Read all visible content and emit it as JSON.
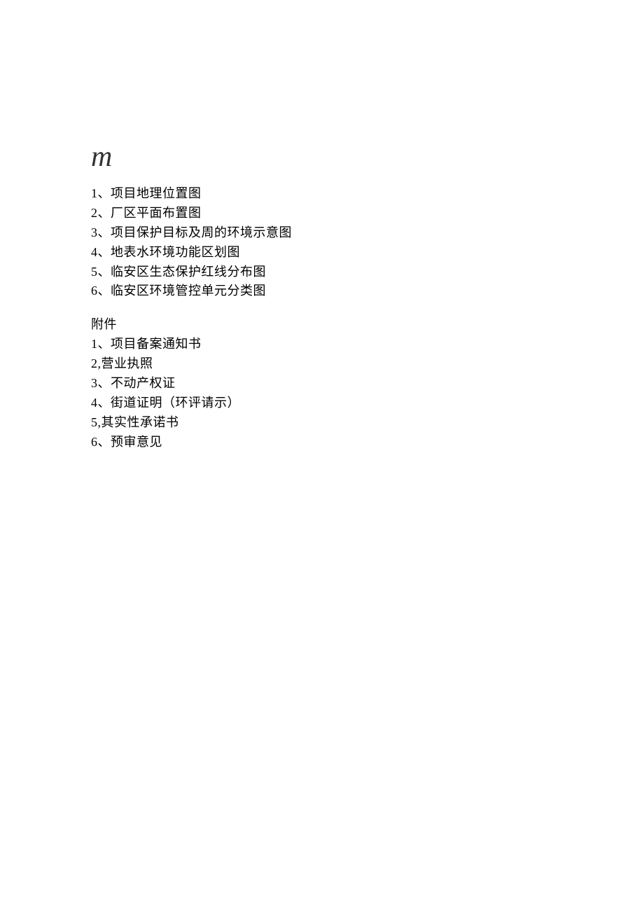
{
  "heading": "m",
  "section1": {
    "items": [
      "1、项目地理位置图",
      "2、厂区平面布置图",
      "3、项目保护目标及周的环境示意图",
      "4、地表水环境功能区划图",
      "5、临安区生态保护红线分布图",
      "6、临安区环境管控单元分类图"
    ]
  },
  "section2": {
    "title": "附件",
    "items": [
      "1、项目备案通知书",
      "2,营业执照",
      "3、不动产权证",
      "4、街道证明（环评请示）",
      "5,其实性承诺书",
      "6、预审意见"
    ]
  }
}
